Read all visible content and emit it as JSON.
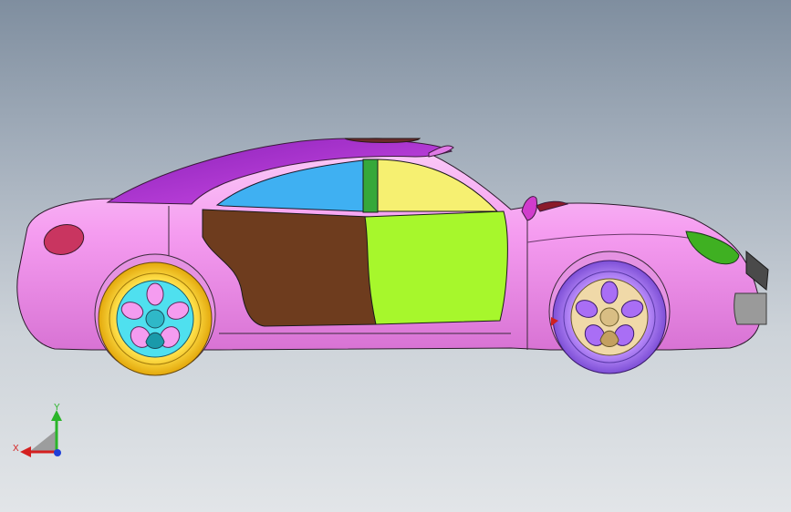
{
  "viewport": {
    "background_top": "#7f8e9f",
    "background_bottom": "#e2e5e8"
  },
  "model": {
    "body_color": "#f59cf0",
    "roof_color": "#b830d8",
    "rear_window_color": "#3fb0f2",
    "front_window_color": "#f6f071",
    "rear_door_color": "#6e3c1e",
    "front_door_color": "#a7f72c",
    "taillight_color": "#c93560",
    "headlight_color": "#3fb022",
    "front_tire_color": "#a96ef5",
    "rear_tire_color": "#f2c20c",
    "front_rim_color": "#f0d9a8",
    "rear_rim_color": "#4fe0ef"
  },
  "triad": {
    "x_label": "X",
    "y_label": "Y",
    "x_color": "#d42020",
    "y_color": "#2ab52a",
    "z_color": "#1f3fd8"
  }
}
